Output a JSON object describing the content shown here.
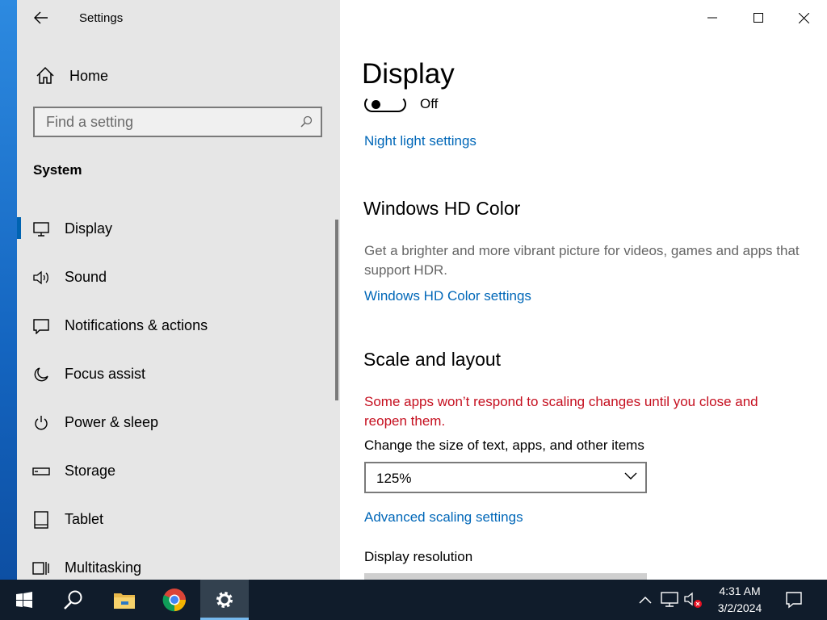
{
  "window": {
    "app_title": "Settings"
  },
  "sidebar": {
    "home_label": "Home",
    "search": {
      "placeholder": "Find a setting",
      "value": ""
    },
    "section_title": "System",
    "items": [
      {
        "label": "Display",
        "icon": "monitor-icon",
        "active": true
      },
      {
        "label": "Sound",
        "icon": "speaker-icon"
      },
      {
        "label": "Notifications & actions",
        "icon": "notification-icon"
      },
      {
        "label": "Focus assist",
        "icon": "moon-icon"
      },
      {
        "label": "Power & sleep",
        "icon": "power-icon"
      },
      {
        "label": "Storage",
        "icon": "storage-icon"
      },
      {
        "label": "Tablet",
        "icon": "tablet-icon"
      },
      {
        "label": "Multitasking",
        "icon": "multitasking-icon"
      }
    ]
  },
  "content": {
    "page_title": "Display",
    "night_light": {
      "toggle_state": "Off",
      "settings_link": "Night light settings"
    },
    "hd_color": {
      "heading": "Windows HD Color",
      "description": "Get a brighter and more vibrant picture for videos, games and apps that support HDR.",
      "settings_link": "Windows HD Color settings"
    },
    "scale_layout": {
      "heading": "Scale and layout",
      "warning": "Some apps won’t respond to scaling changes until you close and reopen them.",
      "size_label": "Change the size of text, apps, and other items",
      "size_value": "125%",
      "advanced_link": "Advanced scaling settings",
      "resolution_label": "Display resolution"
    }
  },
  "taskbar": {
    "apps": [
      "start-icon",
      "search-icon",
      "file-explorer-icon",
      "chrome-icon",
      "settings-icon"
    ],
    "active_app": "settings-icon",
    "clock": {
      "time": "4:31 AM",
      "date": "3/2/2024"
    }
  },
  "colors": {
    "accent": "#0063b1",
    "link": "#0067b8",
    "warning": "#c50f1f",
    "sidebar_bg": "#e6e6e6",
    "taskbar_bg": "#101c2b"
  }
}
